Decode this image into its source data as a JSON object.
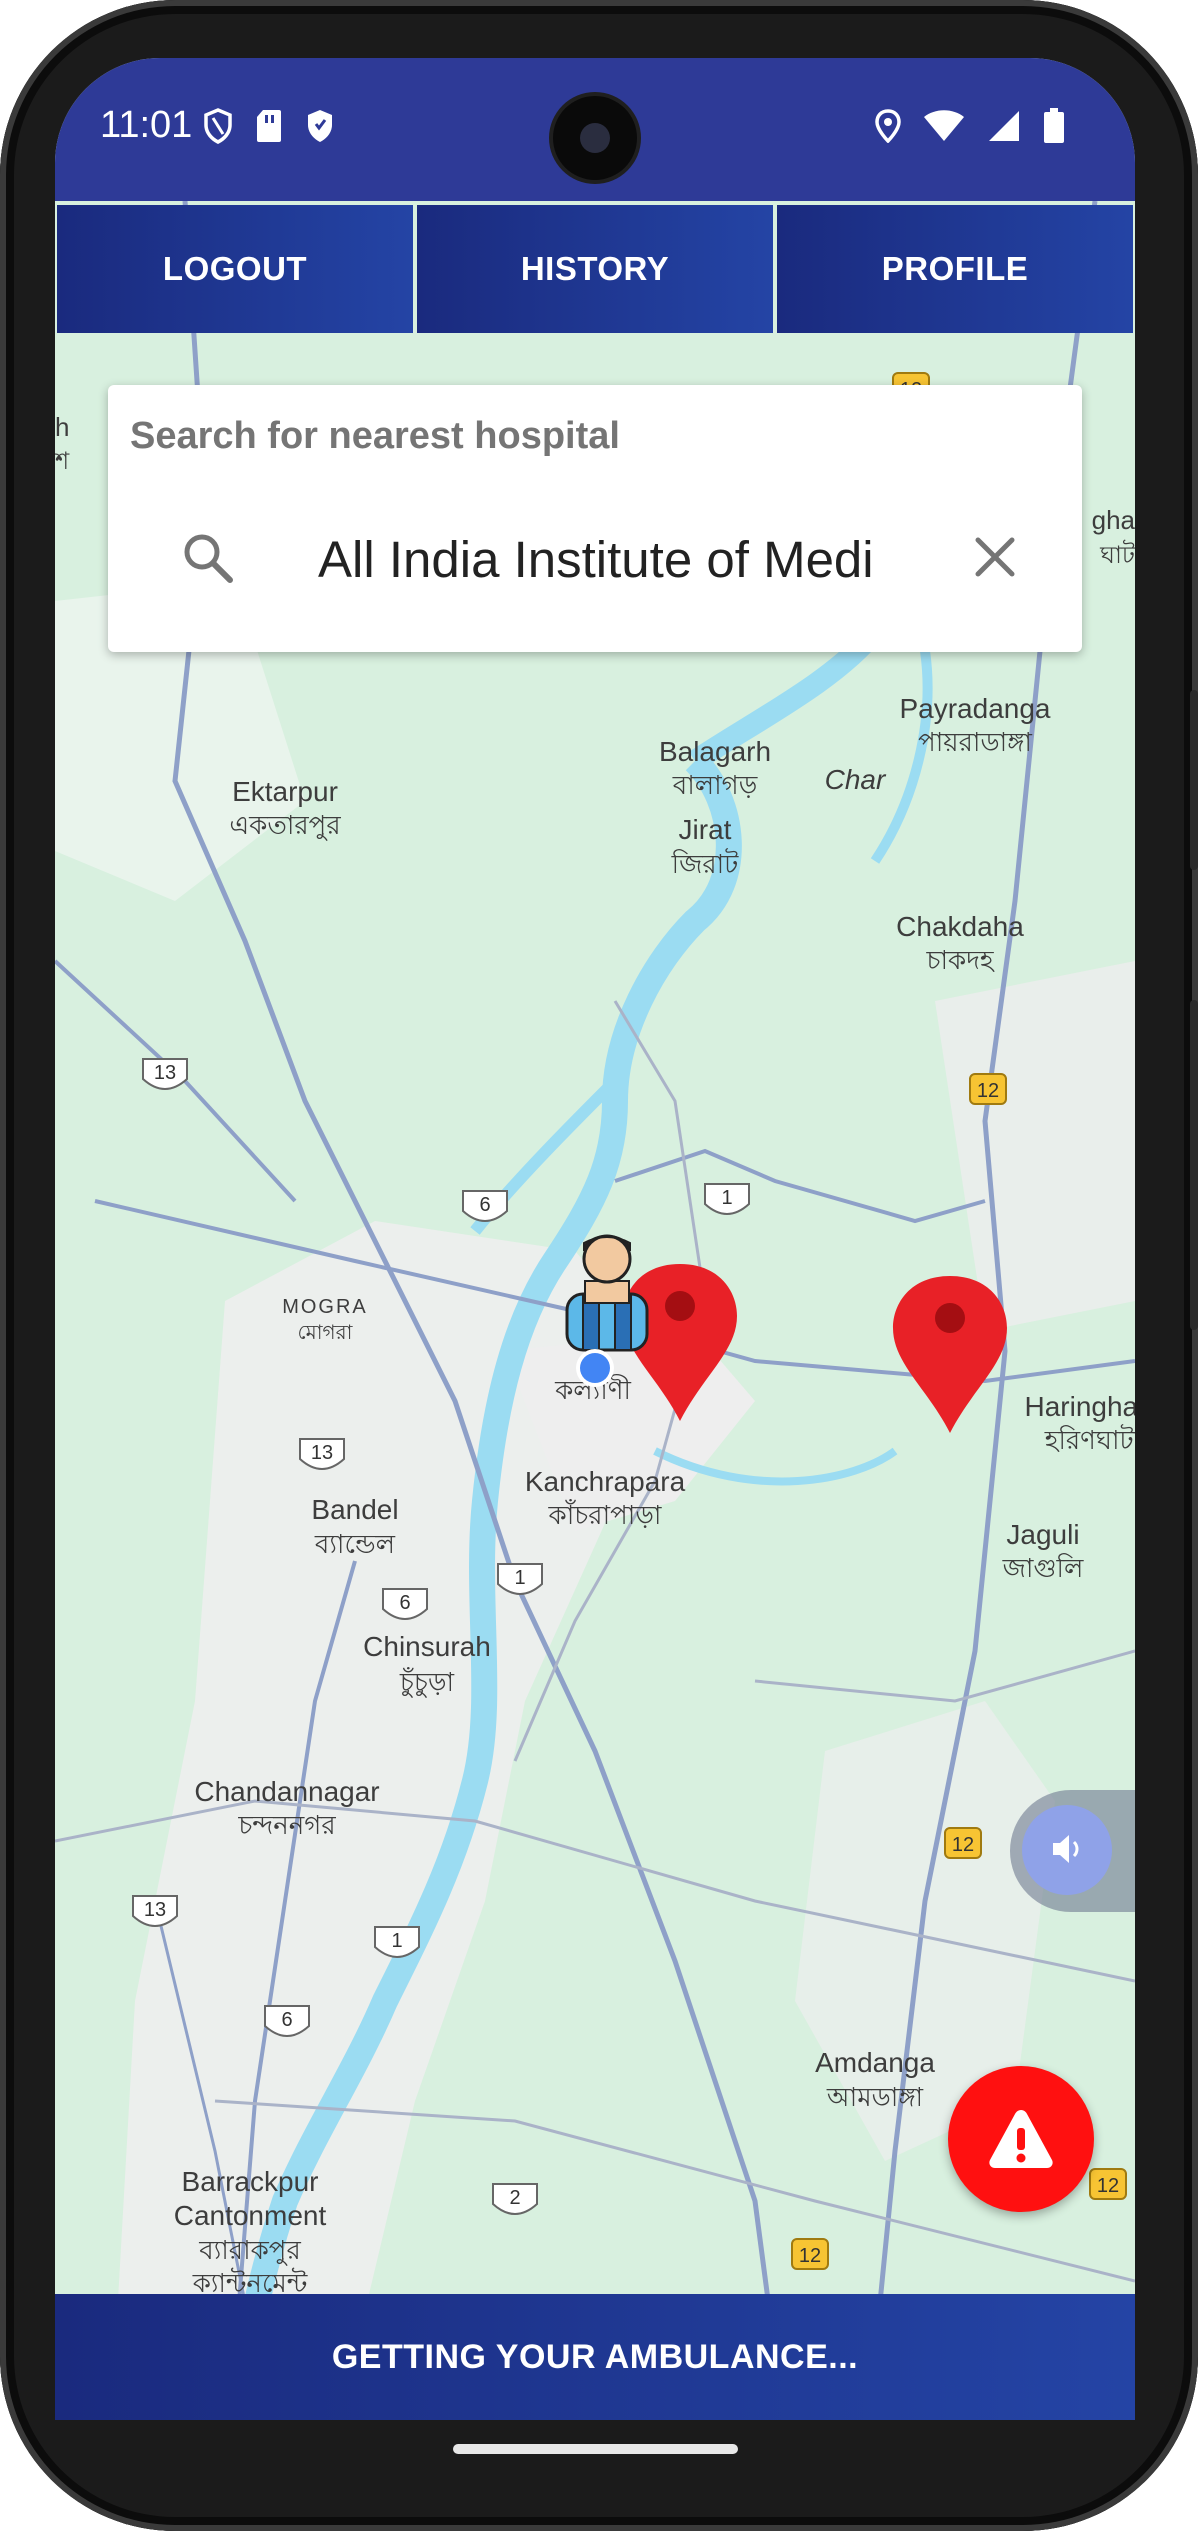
{
  "status": {
    "time": "11:01",
    "left_icons": [
      "shield-outline-icon",
      "sd-card-icon",
      "shield-filled-icon"
    ],
    "right_icons": [
      "location-icon",
      "wifi-icon",
      "signal-icon",
      "battery-icon"
    ]
  },
  "tabs": [
    {
      "label": "LOGOUT"
    },
    {
      "label": "HISTORY"
    },
    {
      "label": "PROFILE"
    }
  ],
  "search": {
    "title": "Search for nearest hospital",
    "value": "All India Institute of Medical Sciences"
  },
  "map": {
    "places": [
      {
        "en": "Ektarpur",
        "bn": "একতারপুর"
      },
      {
        "en": "Balagarh",
        "bn": "বালাগড়"
      },
      {
        "en": "Char",
        "bn": ""
      },
      {
        "en": "Jirat",
        "bn": "জিরাট"
      },
      {
        "en": "Payradanga",
        "bn": "পায়রাডাঙ্গা"
      },
      {
        "en": "Chakdaha",
        "bn": "চাকদহ"
      },
      {
        "en": "MOGRA",
        "bn": "মোগরা"
      },
      {
        "en": "",
        "bn": "কল্যাণী"
      },
      {
        "en": "Kanchrapara",
        "bn": "কাঁচরাপাড়া"
      },
      {
        "en": "Haringhata",
        "bn": "হরিণঘাটা"
      },
      {
        "en": "Bandel",
        "bn": "ব্যান্ডেল"
      },
      {
        "en": "Jaguli",
        "bn": "জাগুলি"
      },
      {
        "en": "Chinsurah",
        "bn": "চুঁচুড়া"
      },
      {
        "en": "Chandannagar",
        "bn": "চন্দননগর"
      },
      {
        "en": "Amdanga",
        "bn": "আমডাঙ্গা"
      },
      {
        "en": "Barrackpur",
        "bn": "ব্যারাকপুর"
      },
      {
        "en": "Cantonment",
        "bn": "ক্যান্টনমেন্ট"
      },
      {
        "en": "gha",
        "bn": "ঘাট"
      },
      {
        "en": "h",
        "bn": "শ"
      }
    ],
    "shields": [
      "13",
      "6",
      "1",
      "12",
      "13",
      "6",
      "1",
      "13",
      "1",
      "6",
      "12",
      "2",
      "12",
      "12",
      "6",
      "12"
    ]
  },
  "bottom_bar": {
    "label": "GETTING YOUR AMBULANCE..."
  },
  "colors": {
    "header": "#2e3a97",
    "tab_gradient_start": "#1a2a7e",
    "tab_gradient_end": "#2444a5",
    "sos": "#ff1010",
    "map_marker": "#e82127",
    "user_location": "#4285f4"
  }
}
